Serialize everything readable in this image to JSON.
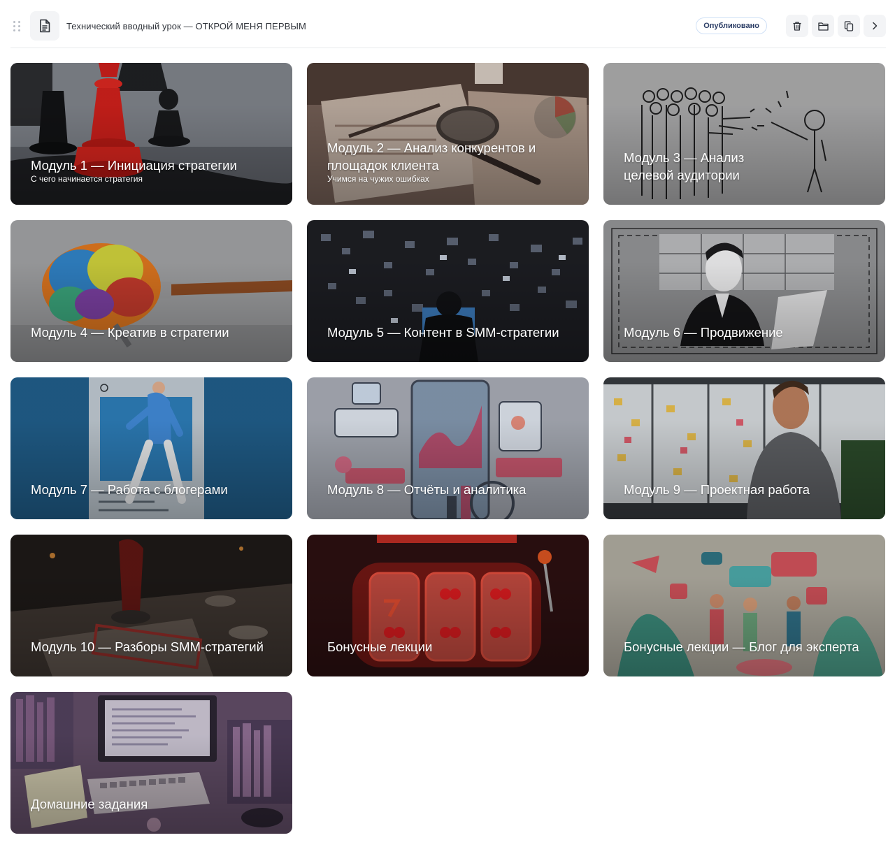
{
  "header": {
    "title": "Технический вводный урок — ОТКРОЙ МЕНЯ ПЕРВЫМ",
    "status": "Опубликовано",
    "icons": [
      "drag-handle-icon",
      "document-icon",
      "trash-icon",
      "folder-icon",
      "copy-icon",
      "chevron-right-icon"
    ]
  },
  "modules": [
    {
      "title": "Модуль 1 — Инициация стратегии",
      "subtitle": "С чего начинается стратегия",
      "image": "chess-pieces"
    },
    {
      "title": "Модуль 2 — Анализ конкурентов и площадок клиента",
      "subtitle": "Учимся на чужих ошибках",
      "image": "magnifier-on-documents"
    },
    {
      "title": "Модуль 3 — Анализ целевой аудитории",
      "subtitle": "",
      "image": "crowd-sketch"
    },
    {
      "title": "Модуль 4 — Креатив в стратегии",
      "subtitle": "",
      "image": "brain-paintbrush"
    },
    {
      "title": "Модуль 5 — Контент в SMM-стратегии",
      "subtitle": "",
      "image": "content-wall"
    },
    {
      "title": "Модуль 6 — Продвижение",
      "subtitle": "",
      "image": "man-laptop-sketch"
    },
    {
      "title": "Модуль 7 — Работа с блогерами",
      "subtitle": "",
      "image": "phone-frame-runner"
    },
    {
      "title": "Модуль 8 — Отчёты и аналитика",
      "subtitle": "",
      "image": "analytics-illustration"
    },
    {
      "title": "Модуль 9 — Проектная работа",
      "subtitle": "",
      "image": "man-sticky-board"
    },
    {
      "title": "Модуль 10 — Разборы SMM-стратегий",
      "subtitle": "",
      "image": "audit-stamp"
    },
    {
      "title": "Бонусные лекции",
      "subtitle": "",
      "image": "bonus-slot-machine"
    },
    {
      "title": "Бонусные лекции — Блог для эксперта",
      "subtitle": "",
      "image": "social-media-people"
    },
    {
      "title": "Домашние задания",
      "subtitle": "",
      "image": "desk-computer"
    }
  ]
}
